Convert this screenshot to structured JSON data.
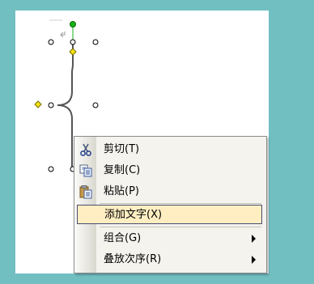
{
  "context_menu": {
    "items": [
      {
        "label": "剪切(T)",
        "icon": "scissors-icon"
      },
      {
        "label": "复制(C)",
        "icon": "copy-icon"
      },
      {
        "label": "粘贴(P)",
        "icon": "paste-icon"
      },
      {
        "label": "添加文字(X)",
        "icon": ""
      },
      {
        "label": "组合(G)",
        "icon": "",
        "submenu": true
      },
      {
        "label": "叠放次序(R)",
        "icon": "",
        "submenu": true
      }
    ],
    "highlighted_item": "添加文字(X)"
  },
  "colors": {
    "background": "#72bfc2",
    "canvas": "#ffffff",
    "handle_green": "#16b216",
    "handle_yellow": "#f3e20f",
    "highlight_fill": "#ffeec2",
    "menu_bg": "#f4f3ee"
  }
}
